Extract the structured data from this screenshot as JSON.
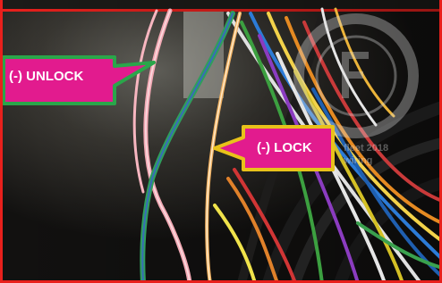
{
  "image": {
    "kind": "close-up photo of vehicle wiring harness",
    "frame_color": "#e8201c"
  },
  "callouts": {
    "unlock": {
      "label": "(-) UNLOCK",
      "fill": "#e21b8e",
      "border": "#2aa64a",
      "text_color": "#ffffff"
    },
    "lock": {
      "label": "(-) LOCK",
      "fill": "#e21b8e",
      "border": "#e8c21a",
      "text_color": "#ffffff"
    }
  },
  "watermark": {
    "logo_glyph": "F",
    "line1": "fleet 2018",
    "line2": "wiring",
    "color": "#d8d8d8"
  }
}
